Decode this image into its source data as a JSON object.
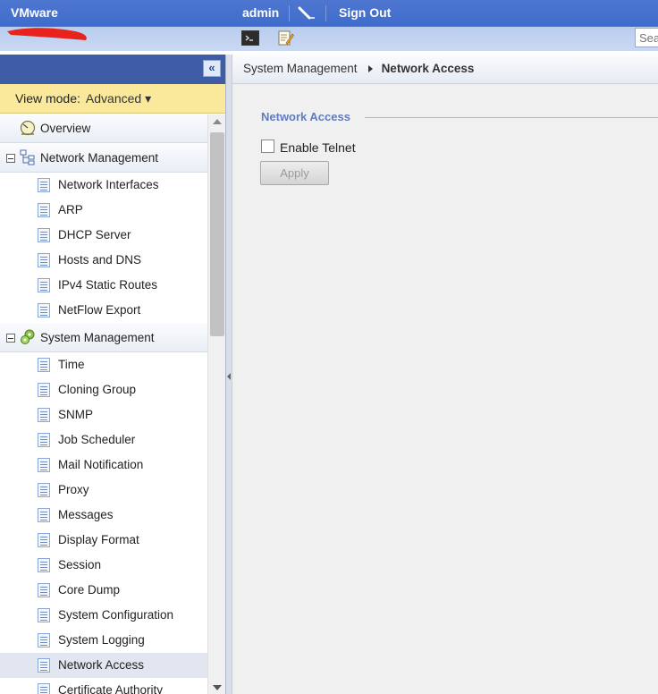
{
  "header": {
    "brand": "VMware",
    "user": "admin",
    "signout_label": "Sign Out",
    "search_placeholder": "Sea"
  },
  "sidebar": {
    "view_mode_label": "View mode:",
    "view_mode_value": "Advanced ▾",
    "overview_label": "Overview",
    "sections": [
      {
        "label": "Network Management",
        "items": [
          "Network Interfaces",
          "ARP",
          "DHCP Server",
          "Hosts and DNS",
          "IPv4 Static Routes",
          "NetFlow Export"
        ]
      },
      {
        "label": "System Management",
        "items": [
          "Time",
          "Cloning Group",
          "SNMP",
          "Job Scheduler",
          "Mail Notification",
          "Proxy",
          "Messages",
          "Display Format",
          "Session",
          "Core Dump",
          "System Configuration",
          "System Logging",
          "Network Access",
          "Certificate Authority"
        ]
      }
    ],
    "selected_item": "Network Access"
  },
  "breadcrumb": {
    "parent": "System Management",
    "current": "Network Access"
  },
  "content": {
    "section_title": "Network Access",
    "telnet_label": "Enable Telnet",
    "telnet_checked": false,
    "apply_label": "Apply"
  },
  "colors": {
    "header_blue": "#3f6ccc",
    "view_mode_bg": "#fae99a",
    "legend_blue": "#5f7cc0",
    "selected_row": "#e2e6f0"
  },
  "icons": [
    "pencil-icon",
    "console-icon",
    "edit-icon",
    "collapse-icon",
    "overview-icon",
    "network-tree-icon",
    "system-gears-icon",
    "page-icon"
  ]
}
